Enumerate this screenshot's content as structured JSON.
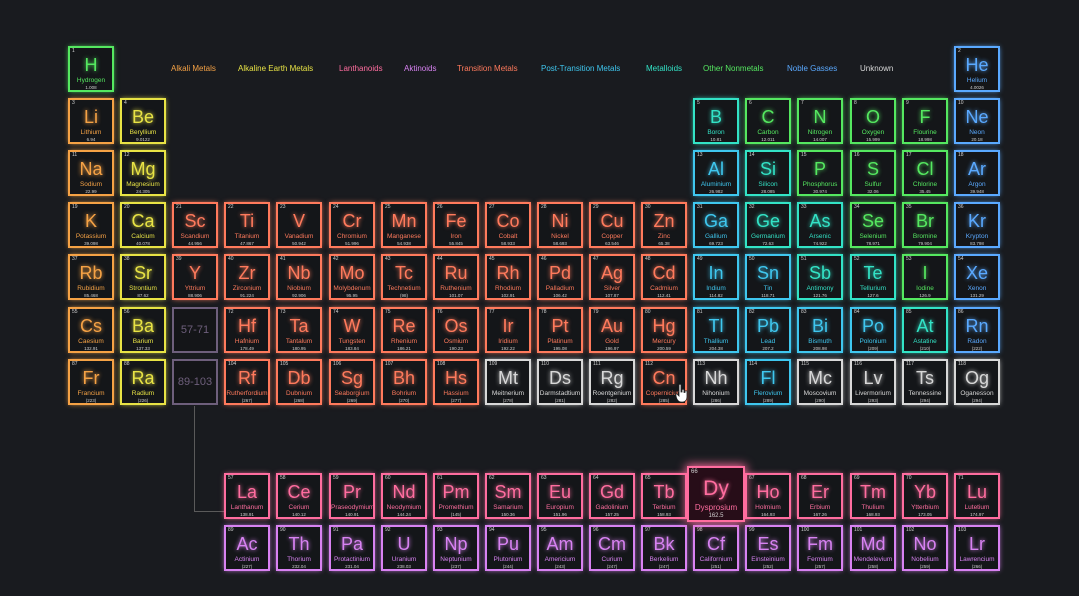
{
  "colors": {
    "alkali": "#f5a245",
    "alkaline": "#e8e345",
    "lanthanoid": "#ff6d9f",
    "actinoid": "#d882f2",
    "transition": "#ff7a5c",
    "post": "#3fc7ef",
    "metalloid": "#33e3c6",
    "nonmetal": "#55e860",
    "noble": "#5aa9ff",
    "unknown": "#d8d8d8",
    "placeholder": "#6e5f7c"
  },
  "legend": [
    {
      "label": "Alkali Metals",
      "cat": "alkali"
    },
    {
      "label": "Alkaline Earth Metals",
      "cat": "alkaline"
    },
    {
      "label": "Lanthanoids",
      "cat": "lanthanoid"
    },
    {
      "label": "Aktinoids",
      "cat": "actinoid"
    },
    {
      "label": "Transition Metals",
      "cat": "transition"
    },
    {
      "label": "Post-Transition Metals",
      "cat": "post"
    },
    {
      "label": "Metalloids",
      "cat": "metalloid"
    },
    {
      "label": "Other Nonmetals",
      "cat": "nonmetal"
    },
    {
      "label": "Noble Gasses",
      "cat": "noble"
    },
    {
      "label": "Unknown",
      "cat": "unknown"
    }
  ],
  "placeholders": [
    {
      "label": "57-71",
      "row": 6,
      "col": 3
    },
    {
      "label": "89-103",
      "row": 7,
      "col": 3
    }
  ],
  "active_element": 66,
  "elements": [
    {
      "n": 1,
      "s": "H",
      "name": "Hydrogen",
      "mass": "1.008",
      "cat": "nonmetal",
      "row": 1,
      "col": 1
    },
    {
      "n": 2,
      "s": "He",
      "name": "Helium",
      "mass": "4.0026",
      "cat": "noble",
      "row": 1,
      "col": 18
    },
    {
      "n": 3,
      "s": "Li",
      "name": "Lithium",
      "mass": "6.94",
      "cat": "alkali",
      "row": 2,
      "col": 1
    },
    {
      "n": 4,
      "s": "Be",
      "name": "Beryllium",
      "mass": "9.0122",
      "cat": "alkaline",
      "row": 2,
      "col": 2
    },
    {
      "n": 5,
      "s": "B",
      "name": "Boron",
      "mass": "10.81",
      "cat": "metalloid",
      "row": 2,
      "col": 13
    },
    {
      "n": 6,
      "s": "C",
      "name": "Carbon",
      "mass": "12.011",
      "cat": "nonmetal",
      "row": 2,
      "col": 14
    },
    {
      "n": 7,
      "s": "N",
      "name": "Nitrogen",
      "mass": "14.007",
      "cat": "nonmetal",
      "row": 2,
      "col": 15
    },
    {
      "n": 8,
      "s": "O",
      "name": "Oxygen",
      "mass": "15.999",
      "cat": "nonmetal",
      "row": 2,
      "col": 16
    },
    {
      "n": 9,
      "s": "F",
      "name": "Flourine",
      "mass": "18.998",
      "cat": "nonmetal",
      "row": 2,
      "col": 17
    },
    {
      "n": 10,
      "s": "Ne",
      "name": "Neon",
      "mass": "20.18",
      "cat": "noble",
      "row": 2,
      "col": 18
    },
    {
      "n": 11,
      "s": "Na",
      "name": "Sodium",
      "mass": "22.99",
      "cat": "alkali",
      "row": 3,
      "col": 1
    },
    {
      "n": 12,
      "s": "Mg",
      "name": "Magnesium",
      "mass": "24.305",
      "cat": "alkaline",
      "row": 3,
      "col": 2
    },
    {
      "n": 13,
      "s": "Al",
      "name": "Aluminium",
      "mass": "26.982",
      "cat": "post",
      "row": 3,
      "col": 13
    },
    {
      "n": 14,
      "s": "Si",
      "name": "Silicon",
      "mass": "28.085",
      "cat": "metalloid",
      "row": 3,
      "col": 14
    },
    {
      "n": 15,
      "s": "P",
      "name": "Phosphorus",
      "mass": "30.974",
      "cat": "nonmetal",
      "row": 3,
      "col": 15
    },
    {
      "n": 16,
      "s": "S",
      "name": "Sulfur",
      "mass": "32.06",
      "cat": "nonmetal",
      "row": 3,
      "col": 16
    },
    {
      "n": 17,
      "s": "Cl",
      "name": "Chlorine",
      "mass": "35.45",
      "cat": "nonmetal",
      "row": 3,
      "col": 17
    },
    {
      "n": 18,
      "s": "Ar",
      "name": "Argon",
      "mass": "39.948",
      "cat": "noble",
      "row": 3,
      "col": 18
    },
    {
      "n": 19,
      "s": "K",
      "name": "Potassium",
      "mass": "39.098",
      "cat": "alkali",
      "row": 4,
      "col": 1
    },
    {
      "n": 20,
      "s": "Ca",
      "name": "Calcium",
      "mass": "40.078",
      "cat": "alkaline",
      "row": 4,
      "col": 2
    },
    {
      "n": 21,
      "s": "Sc",
      "name": "Scandium",
      "mass": "44.956",
      "cat": "transition",
      "row": 4,
      "col": 3
    },
    {
      "n": 22,
      "s": "Ti",
      "name": "Titanium",
      "mass": "47.867",
      "cat": "transition",
      "row": 4,
      "col": 4
    },
    {
      "n": 23,
      "s": "V",
      "name": "Vanadium",
      "mass": "50.942",
      "cat": "transition",
      "row": 4,
      "col": 5
    },
    {
      "n": 24,
      "s": "Cr",
      "name": "Chromium",
      "mass": "51.996",
      "cat": "transition",
      "row": 4,
      "col": 6
    },
    {
      "n": 25,
      "s": "Mn",
      "name": "Manganese",
      "mass": "54.938",
      "cat": "transition",
      "row": 4,
      "col": 7
    },
    {
      "n": 26,
      "s": "Fe",
      "name": "Iron",
      "mass": "55.845",
      "cat": "transition",
      "row": 4,
      "col": 8
    },
    {
      "n": 27,
      "s": "Co",
      "name": "Cobalt",
      "mass": "58.933",
      "cat": "transition",
      "row": 4,
      "col": 9
    },
    {
      "n": 28,
      "s": "Ni",
      "name": "Nickel",
      "mass": "58.693",
      "cat": "transition",
      "row": 4,
      "col": 10
    },
    {
      "n": 29,
      "s": "Cu",
      "name": "Copper",
      "mass": "63.546",
      "cat": "transition",
      "row": 4,
      "col": 11
    },
    {
      "n": 30,
      "s": "Zn",
      "name": "Zinc",
      "mass": "65.38",
      "cat": "transition",
      "row": 4,
      "col": 12
    },
    {
      "n": 31,
      "s": "Ga",
      "name": "Gallium",
      "mass": "69.723",
      "cat": "post",
      "row": 4,
      "col": 13
    },
    {
      "n": 32,
      "s": "Ge",
      "name": "Germanium",
      "mass": "72.63",
      "cat": "metalloid",
      "row": 4,
      "col": 14
    },
    {
      "n": 33,
      "s": "As",
      "name": "Arsenic",
      "mass": "74.922",
      "cat": "metalloid",
      "row": 4,
      "col": 15
    },
    {
      "n": 34,
      "s": "Se",
      "name": "Selenium",
      "mass": "78.971",
      "cat": "nonmetal",
      "row": 4,
      "col": 16
    },
    {
      "n": 35,
      "s": "Br",
      "name": "Bromine",
      "mass": "79.904",
      "cat": "nonmetal",
      "row": 4,
      "col": 17
    },
    {
      "n": 36,
      "s": "Kr",
      "name": "Krypton",
      "mass": "83.798",
      "cat": "noble",
      "row": 4,
      "col": 18
    },
    {
      "n": 37,
      "s": "Rb",
      "name": "Rubidium",
      "mass": "85.468",
      "cat": "alkali",
      "row": 5,
      "col": 1
    },
    {
      "n": 38,
      "s": "Sr",
      "name": "Strontium",
      "mass": "87.62",
      "cat": "alkaline",
      "row": 5,
      "col": 2
    },
    {
      "n": 39,
      "s": "Y",
      "name": "Yttrium",
      "mass": "88.906",
      "cat": "transition",
      "row": 5,
      "col": 3
    },
    {
      "n": 40,
      "s": "Zr",
      "name": "Zirconium",
      "mass": "91.224",
      "cat": "transition",
      "row": 5,
      "col": 4
    },
    {
      "n": 41,
      "s": "Nb",
      "name": "Niobium",
      "mass": "92.906",
      "cat": "transition",
      "row": 5,
      "col": 5
    },
    {
      "n": 42,
      "s": "Mo",
      "name": "Molybdenum",
      "mass": "95.95",
      "cat": "transition",
      "row": 5,
      "col": 6
    },
    {
      "n": 43,
      "s": "Tc",
      "name": "Technetium",
      "mass": "(98)",
      "cat": "transition",
      "row": 5,
      "col": 7
    },
    {
      "n": 44,
      "s": "Ru",
      "name": "Ruthenium",
      "mass": "101.07",
      "cat": "transition",
      "row": 5,
      "col": 8
    },
    {
      "n": 45,
      "s": "Rh",
      "name": "Rhodium",
      "mass": "102.91",
      "cat": "transition",
      "row": 5,
      "col": 9
    },
    {
      "n": 46,
      "s": "Pd",
      "name": "Palladium",
      "mass": "106.42",
      "cat": "transition",
      "row": 5,
      "col": 10
    },
    {
      "n": 47,
      "s": "Ag",
      "name": "Silver",
      "mass": "107.87",
      "cat": "transition",
      "row": 5,
      "col": 11
    },
    {
      "n": 48,
      "s": "Cd",
      "name": "Cadmium",
      "mass": "112.41",
      "cat": "transition",
      "row": 5,
      "col": 12
    },
    {
      "n": 49,
      "s": "In",
      "name": "Indium",
      "mass": "114.82",
      "cat": "post",
      "row": 5,
      "col": 13
    },
    {
      "n": 50,
      "s": "Sn",
      "name": "Tin",
      "mass": "118.71",
      "cat": "post",
      "row": 5,
      "col": 14
    },
    {
      "n": 51,
      "s": "Sb",
      "name": "Antimony",
      "mass": "121.76",
      "cat": "metalloid",
      "row": 5,
      "col": 15
    },
    {
      "n": 52,
      "s": "Te",
      "name": "Tellurium",
      "mass": "127.6",
      "cat": "metalloid",
      "row": 5,
      "col": 16
    },
    {
      "n": 53,
      "s": "I",
      "name": "Iodine",
      "mass": "126.9",
      "cat": "nonmetal",
      "row": 5,
      "col": 17
    },
    {
      "n": 54,
      "s": "Xe",
      "name": "Xenon",
      "mass": "131.29",
      "cat": "noble",
      "row": 5,
      "col": 18
    },
    {
      "n": 55,
      "s": "Cs",
      "name": "Caesium",
      "mass": "132.91",
      "cat": "alkali",
      "row": 6,
      "col": 1
    },
    {
      "n": 56,
      "s": "Ba",
      "name": "Barium",
      "mass": "137.33",
      "cat": "alkaline",
      "row": 6,
      "col": 2
    },
    {
      "n": 72,
      "s": "Hf",
      "name": "Hafnium",
      "mass": "178.49",
      "cat": "transition",
      "row": 6,
      "col": 4
    },
    {
      "n": 73,
      "s": "Ta",
      "name": "Tantalum",
      "mass": "180.95",
      "cat": "transition",
      "row": 6,
      "col": 5
    },
    {
      "n": 74,
      "s": "W",
      "name": "Tungsten",
      "mass": "183.84",
      "cat": "transition",
      "row": 6,
      "col": 6
    },
    {
      "n": 75,
      "s": "Re",
      "name": "Rhenium",
      "mass": "186.21",
      "cat": "transition",
      "row": 6,
      "col": 7
    },
    {
      "n": 76,
      "s": "Os",
      "name": "Osmium",
      "mass": "190.23",
      "cat": "transition",
      "row": 6,
      "col": 8
    },
    {
      "n": 77,
      "s": "Ir",
      "name": "Iridium",
      "mass": "192.22",
      "cat": "transition",
      "row": 6,
      "col": 9
    },
    {
      "n": 78,
      "s": "Pt",
      "name": "Platinum",
      "mass": "195.08",
      "cat": "transition",
      "row": 6,
      "col": 10
    },
    {
      "n": 79,
      "s": "Au",
      "name": "Gold",
      "mass": "196.97",
      "cat": "transition",
      "row": 6,
      "col": 11
    },
    {
      "n": 80,
      "s": "Hg",
      "name": "Mercury",
      "mass": "200.59",
      "cat": "transition",
      "row": 6,
      "col": 12
    },
    {
      "n": 81,
      "s": "Tl",
      "name": "Thallium",
      "mass": "204.38",
      "cat": "post",
      "row": 6,
      "col": 13
    },
    {
      "n": 82,
      "s": "Pb",
      "name": "Lead",
      "mass": "207.2",
      "cat": "post",
      "row": 6,
      "col": 14
    },
    {
      "n": 83,
      "s": "Bi",
      "name": "Bismuth",
      "mass": "208.98",
      "cat": "post",
      "row": 6,
      "col": 15
    },
    {
      "n": 84,
      "s": "Po",
      "name": "Polonium",
      "mass": "(209)",
      "cat": "post",
      "row": 6,
      "col": 16
    },
    {
      "n": 85,
      "s": "At",
      "name": "Astatine",
      "mass": "(210)",
      "cat": "metalloid",
      "row": 6,
      "col": 17
    },
    {
      "n": 86,
      "s": "Rn",
      "name": "Radon",
      "mass": "(222)",
      "cat": "noble",
      "row": 6,
      "col": 18
    },
    {
      "n": 87,
      "s": "Fr",
      "name": "Francium",
      "mass": "(223)",
      "cat": "alkali",
      "row": 7,
      "col": 1
    },
    {
      "n": 88,
      "s": "Ra",
      "name": "Radium",
      "mass": "(226)",
      "cat": "alkaline",
      "row": 7,
      "col": 2
    },
    {
      "n": 104,
      "s": "Rf",
      "name": "Rutherfordium",
      "mass": "(267)",
      "cat": "transition",
      "row": 7,
      "col": 4
    },
    {
      "n": 105,
      "s": "Db",
      "name": "Dubnium",
      "mass": "(268)",
      "cat": "transition",
      "row": 7,
      "col": 5
    },
    {
      "n": 106,
      "s": "Sg",
      "name": "Seaborgium",
      "mass": "(269)",
      "cat": "transition",
      "row": 7,
      "col": 6
    },
    {
      "n": 107,
      "s": "Bh",
      "name": "Bohrium",
      "mass": "(270)",
      "cat": "transition",
      "row": 7,
      "col": 7
    },
    {
      "n": 108,
      "s": "Hs",
      "name": "Hassium",
      "mass": "(277)",
      "cat": "transition",
      "row": 7,
      "col": 8
    },
    {
      "n": 109,
      "s": "Mt",
      "name": "Meitnerium",
      "mass": "(278)",
      "cat": "unknown",
      "row": 7,
      "col": 9
    },
    {
      "n": 110,
      "s": "Ds",
      "name": "Darmstadtium",
      "mass": "(281)",
      "cat": "unknown",
      "row": 7,
      "col": 10
    },
    {
      "n": 111,
      "s": "Rg",
      "name": "Roentgenium",
      "mass": "(282)",
      "cat": "unknown",
      "row": 7,
      "col": 11
    },
    {
      "n": 112,
      "s": "Cn",
      "name": "Copernicium",
      "mass": "(285)",
      "cat": "transition",
      "row": 7,
      "col": 12
    },
    {
      "n": 113,
      "s": "Nh",
      "name": "Nihonium",
      "mass": "(286)",
      "cat": "unknown",
      "row": 7,
      "col": 13
    },
    {
      "n": 114,
      "s": "Fl",
      "name": "Flerovium",
      "mass": "(289)",
      "cat": "post",
      "row": 7,
      "col": 14
    },
    {
      "n": 115,
      "s": "Mc",
      "name": "Moscovium",
      "mass": "(290)",
      "cat": "unknown",
      "row": 7,
      "col": 15
    },
    {
      "n": 116,
      "s": "Lv",
      "name": "Livermorium",
      "mass": "(293)",
      "cat": "unknown",
      "row": 7,
      "col": 16
    },
    {
      "n": 117,
      "s": "Ts",
      "name": "Tennessine",
      "mass": "(294)",
      "cat": "unknown",
      "row": 7,
      "col": 17
    },
    {
      "n": 118,
      "s": "Og",
      "name": "Oganesson",
      "mass": "(294)",
      "cat": "unknown",
      "row": 7,
      "col": 18
    },
    {
      "n": 57,
      "s": "La",
      "name": "Lanthanum",
      "mass": "138.91",
      "cat": "lanthanoid",
      "row": 9,
      "col": 4
    },
    {
      "n": 58,
      "s": "Ce",
      "name": "Cerium",
      "mass": "140.12",
      "cat": "lanthanoid",
      "row": 9,
      "col": 5
    },
    {
      "n": 59,
      "s": "Pr",
      "name": "Praseodymium",
      "mass": "140.91",
      "cat": "lanthanoid",
      "row": 9,
      "col": 6
    },
    {
      "n": 60,
      "s": "Nd",
      "name": "Neodymium",
      "mass": "144.24",
      "cat": "lanthanoid",
      "row": 9,
      "col": 7
    },
    {
      "n": 61,
      "s": "Pm",
      "name": "Promethium",
      "mass": "(145)",
      "cat": "lanthanoid",
      "row": 9,
      "col": 8
    },
    {
      "n": 62,
      "s": "Sm",
      "name": "Samarium",
      "mass": "150.36",
      "cat": "lanthanoid",
      "row": 9,
      "col": 9
    },
    {
      "n": 63,
      "s": "Eu",
      "name": "Europium",
      "mass": "151.96",
      "cat": "lanthanoid",
      "row": 9,
      "col": 10
    },
    {
      "n": 64,
      "s": "Gd",
      "name": "Gadolinium",
      "mass": "157.25",
      "cat": "lanthanoid",
      "row": 9,
      "col": 11
    },
    {
      "n": 65,
      "s": "Tb",
      "name": "Terbium",
      "mass": "158.93",
      "cat": "lanthanoid",
      "row": 9,
      "col": 12
    },
    {
      "n": 66,
      "s": "Dy",
      "name": "Dysprosium",
      "mass": "162.5",
      "cat": "lanthanoid",
      "row": 9,
      "col": 13
    },
    {
      "n": 67,
      "s": "Ho",
      "name": "Holmium",
      "mass": "164.93",
      "cat": "lanthanoid",
      "row": 9,
      "col": 14
    },
    {
      "n": 68,
      "s": "Er",
      "name": "Erbium",
      "mass": "167.26",
      "cat": "lanthanoid",
      "row": 9,
      "col": 15
    },
    {
      "n": 69,
      "s": "Tm",
      "name": "Thulium",
      "mass": "168.93",
      "cat": "lanthanoid",
      "row": 9,
      "col": 16
    },
    {
      "n": 70,
      "s": "Yb",
      "name": "Ytterbium",
      "mass": "173.05",
      "cat": "lanthanoid",
      "row": 9,
      "col": 17
    },
    {
      "n": 71,
      "s": "Lu",
      "name": "Lutetium",
      "mass": "174.97",
      "cat": "lanthanoid",
      "row": 9,
      "col": 18
    },
    {
      "n": 89,
      "s": "Ac",
      "name": "Actinium",
      "mass": "(227)",
      "cat": "actinoid",
      "row": 10,
      "col": 4
    },
    {
      "n": 90,
      "s": "Th",
      "name": "Thorium",
      "mass": "232.04",
      "cat": "actinoid",
      "row": 10,
      "col": 5
    },
    {
      "n": 91,
      "s": "Pa",
      "name": "Protactinium",
      "mass": "231.04",
      "cat": "actinoid",
      "row": 10,
      "col": 6
    },
    {
      "n": 92,
      "s": "U",
      "name": "Uranium",
      "mass": "238.03",
      "cat": "actinoid",
      "row": 10,
      "col": 7
    },
    {
      "n": 93,
      "s": "Np",
      "name": "Neptunium",
      "mass": "(237)",
      "cat": "actinoid",
      "row": 10,
      "col": 8
    },
    {
      "n": 94,
      "s": "Pu",
      "name": "Plutonium",
      "mass": "(244)",
      "cat": "actinoid",
      "row": 10,
      "col": 9
    },
    {
      "n": 95,
      "s": "Am",
      "name": "Americium",
      "mass": "(243)",
      "cat": "actinoid",
      "row": 10,
      "col": 10
    },
    {
      "n": 96,
      "s": "Cm",
      "name": "Curium",
      "mass": "(247)",
      "cat": "actinoid",
      "row": 10,
      "col": 11
    },
    {
      "n": 97,
      "s": "Bk",
      "name": "Berkelium",
      "mass": "(247)",
      "cat": "actinoid",
      "row": 10,
      "col": 12
    },
    {
      "n": 98,
      "s": "Cf",
      "name": "Californium",
      "mass": "(251)",
      "cat": "actinoid",
      "row": 10,
      "col": 13
    },
    {
      "n": 99,
      "s": "Es",
      "name": "Einsteinium",
      "mass": "(252)",
      "cat": "actinoid",
      "row": 10,
      "col": 14
    },
    {
      "n": 100,
      "s": "Fm",
      "name": "Fermium",
      "mass": "(257)",
      "cat": "actinoid",
      "row": 10,
      "col": 15
    },
    {
      "n": 101,
      "s": "Md",
      "name": "Mendelevium",
      "mass": "(258)",
      "cat": "actinoid",
      "row": 10,
      "col": 16
    },
    {
      "n": 102,
      "s": "No",
      "name": "Nobelium",
      "mass": "(259)",
      "cat": "actinoid",
      "row": 10,
      "col": 17
    },
    {
      "n": 103,
      "s": "Lr",
      "name": "Lawrencium",
      "mass": "(266)",
      "cat": "actinoid",
      "row": 10,
      "col": 18
    }
  ]
}
